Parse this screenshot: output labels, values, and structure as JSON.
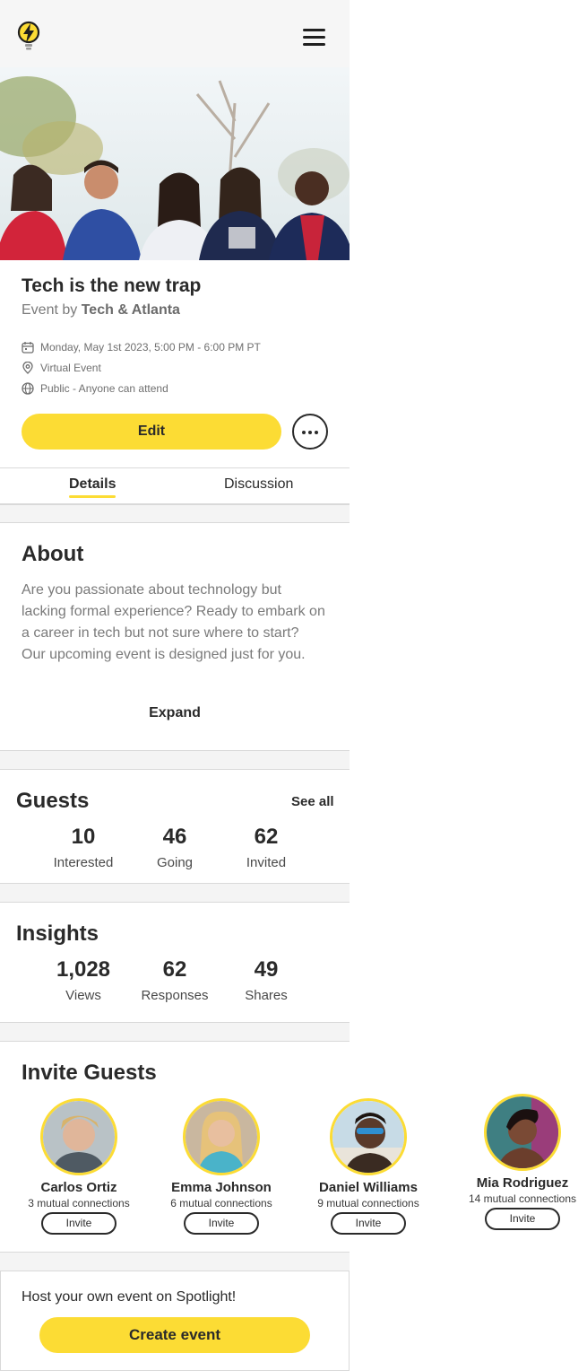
{
  "header": {
    "logo_icon": "lightbulb-bolt-icon",
    "menu_icon": "hamburger-icon"
  },
  "event": {
    "title": "Tech is the new trap",
    "by_prefix": "Event by",
    "host": "Tech & Atlanta",
    "date": "Monday, May 1st 2023, 5:00 PM - 6:00 PM PT",
    "location": "Virtual Event",
    "privacy": "Public - Anyone can attend"
  },
  "actions": {
    "edit_label": "Edit",
    "more_icon": "more-horizontal-icon"
  },
  "tabs": [
    {
      "label": "Details",
      "active": true
    },
    {
      "label": "Discussion",
      "active": false
    }
  ],
  "about": {
    "title": "About",
    "text": "Are you passionate about technology but lacking formal experience? Ready to embark on a career in tech but not sure where to start? Our upcoming event is designed just for you.",
    "expand_label": "Expand"
  },
  "guests": {
    "title": "Guests",
    "see_all_label": "See all",
    "stats": [
      {
        "value": "10",
        "label": "Interested"
      },
      {
        "value": "46",
        "label": "Going"
      },
      {
        "value": "62",
        "label": "Invited"
      }
    ]
  },
  "insights": {
    "title": "Insights",
    "stats": [
      {
        "value": "1,028",
        "label": "Views"
      },
      {
        "value": "62",
        "label": "Responses"
      },
      {
        "value": "49",
        "label": "Shares"
      }
    ]
  },
  "invite": {
    "title": "Invite Guests",
    "people": [
      {
        "name": "Carlos Ortiz",
        "mutual": "3 mutual connections",
        "button": "Invite"
      },
      {
        "name": "Emma Johnson",
        "mutual": "6 mutual connections",
        "button": "Invite"
      },
      {
        "name": "Daniel Williams",
        "mutual": "9 mutual connections",
        "button": "Invite"
      },
      {
        "name": "Mia Rodriguez",
        "mutual": "14 mutual connections",
        "button": "Invite"
      }
    ]
  },
  "host_cta": {
    "text": "Host your own event on Spotlight!",
    "button_label": "Create event"
  },
  "colors": {
    "accent": "#fcdc34",
    "text": "#2a2a2a",
    "muted": "#7a7a7a",
    "border": "#d9d9d9"
  }
}
